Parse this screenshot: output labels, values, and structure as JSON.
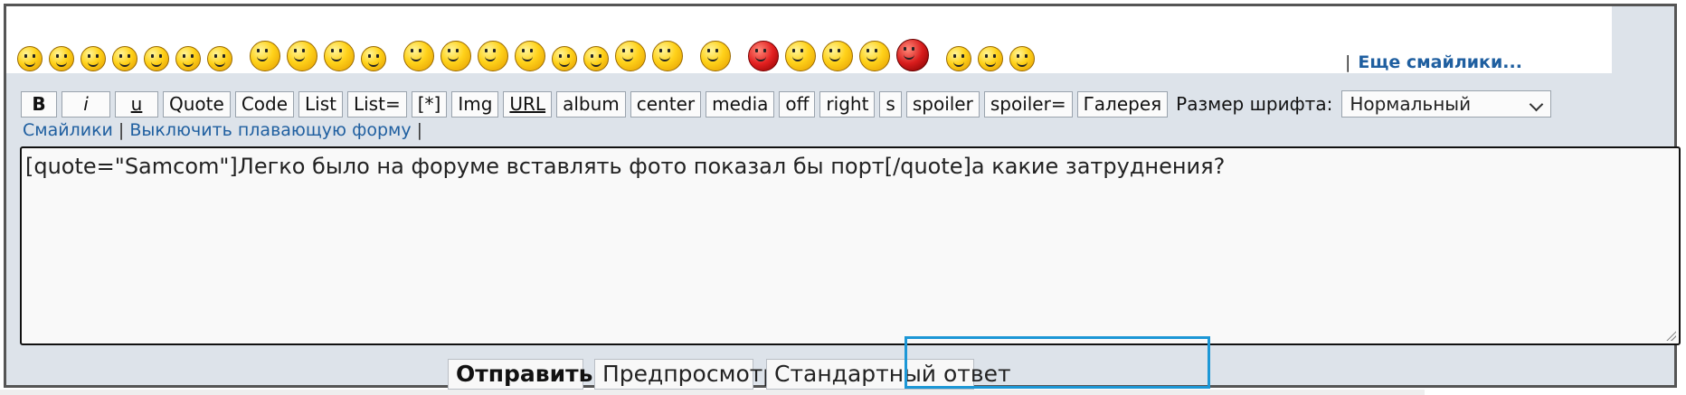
{
  "smilies": {
    "items": [
      {
        "icon": "grin-smiley-icon"
      },
      {
        "icon": "smile-smiley-icon"
      },
      {
        "icon": "sad-smiley-icon"
      },
      {
        "icon": "confused-smiley-icon"
      },
      {
        "icon": "angry-smiley-icon"
      },
      {
        "icon": "kiss-smiley-icon"
      },
      {
        "icon": "sleepy-smiley-icon"
      },
      {
        "icon": "blush-smiley-icon"
      },
      {
        "icon": "wave-smiley-icon"
      },
      {
        "icon": "wink-smiley-icon"
      },
      {
        "icon": "cry-smiley-icon"
      },
      {
        "icon": "dance-smiley-icon"
      },
      {
        "icon": "hungry-smiley-icon"
      },
      {
        "icon": "beer-smiley-icon"
      },
      {
        "icon": "thumbsup-smiley-icon"
      },
      {
        "icon": "surprised-smiley-icon"
      },
      {
        "icon": "cool-smiley-icon"
      },
      {
        "icon": "read-smiley-icon"
      },
      {
        "icon": "thinking-smiley-icon"
      },
      {
        "icon": "rofl-smiley-icon"
      },
      {
        "icon": "mad-smiley-icon"
      },
      {
        "icon": "shock-smiley-icon"
      },
      {
        "icon": "facepalm-smiley-icon"
      },
      {
        "icon": "idea-smiley-icon"
      },
      {
        "icon": "devil-smiley-icon"
      },
      {
        "icon": "neutral-smiley-icon"
      },
      {
        "icon": "scared-smiley-icon"
      },
      {
        "icon": "yes-smiley-icon"
      }
    ],
    "more_link": "Еще смайлики..."
  },
  "toolbar": {
    "buttons": {
      "b": "B",
      "i": "i",
      "u": "u",
      "quote": "Quote",
      "code": "Code",
      "list": "List",
      "list_eq": "List=",
      "star": "[*]",
      "img": "Img",
      "url": "URL",
      "album": "album",
      "center": "center",
      "media": "media",
      "off": "off",
      "right": "right",
      "s": "s",
      "spoiler": "spoiler",
      "spoiler_eq": "spoiler=",
      "gallery": "Галерея"
    },
    "font_size_label": "Размер шрифта:",
    "font_size_value": "Нормальный"
  },
  "links": {
    "smilies": "Смайлики",
    "disable_floating": "Выключить плавающую форму"
  },
  "editor": {
    "text": "[quote=\"Samcom\"]Легко было на форуме вставлять фото показал бы порт[/quote]а какие затруднения?"
  },
  "actions": {
    "send": "Отправить",
    "preview": "Предпросмотр",
    "standard_reply": "Стандартный ответ"
  },
  "colors": {
    "link": "#1f5fa0",
    "highlight": "#1c97d6",
    "panel_bg": "#dde3ea"
  }
}
